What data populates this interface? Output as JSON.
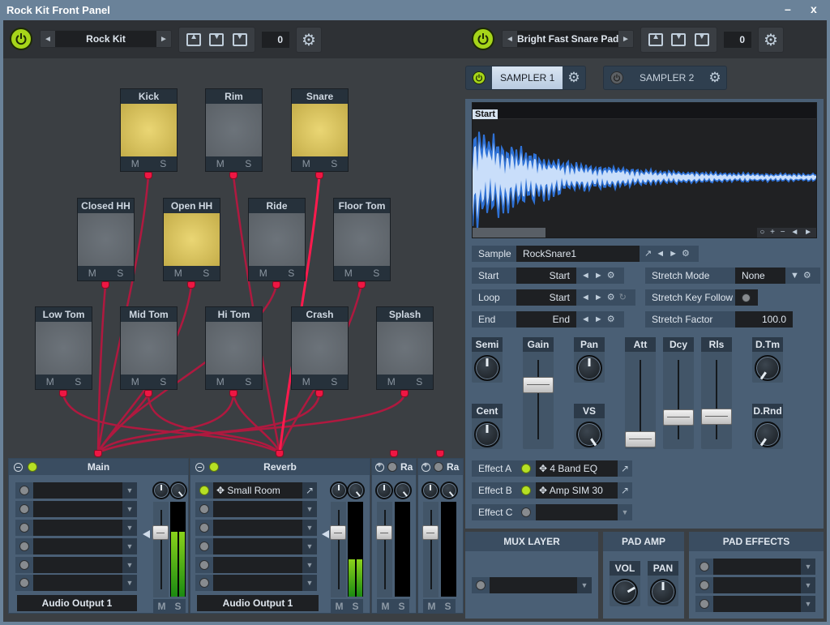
{
  "window": {
    "title": "Rock Kit Front Panel",
    "minimize_label": "–",
    "close_label": "x"
  },
  "left_toolbar": {
    "preset_name": "Rock Kit",
    "number_value": "0"
  },
  "right_toolbar": {
    "preset_name": "Bright Fast Snare Pad",
    "number_value": "0"
  },
  "icons": {
    "prev": "◄",
    "next": "►",
    "dropdown": "▼",
    "gear": "⚙",
    "external": "↗",
    "move": "✥",
    "loop": "↻"
  },
  "pads": [
    {
      "name": "Kick",
      "active": true,
      "mute": "M",
      "solo": "S"
    },
    {
      "name": "Rim",
      "active": false,
      "mute": "M",
      "solo": "S"
    },
    {
      "name": "Snare",
      "active": true,
      "mute": "M",
      "solo": "S"
    },
    {
      "name": "Closed HH",
      "active": false,
      "mute": "M",
      "solo": "S"
    },
    {
      "name": "Open HH",
      "active": true,
      "mute": "M",
      "solo": "S"
    },
    {
      "name": "Ride",
      "active": false,
      "mute": "M",
      "solo": "S"
    },
    {
      "name": "Floor Tom",
      "active": false,
      "mute": "M",
      "solo": "S"
    },
    {
      "name": "Low Tom",
      "active": false,
      "mute": "M",
      "solo": "S"
    },
    {
      "name": "Mid Tom",
      "active": false,
      "mute": "M",
      "solo": "S"
    },
    {
      "name": "Hi Tom",
      "active": false,
      "mute": "M",
      "solo": "S"
    },
    {
      "name": "Crash",
      "active": false,
      "mute": "M",
      "solo": "S"
    },
    {
      "name": "Splash",
      "active": false,
      "mute": "M",
      "solo": "S"
    }
  ],
  "mixer": {
    "main": {
      "name": "Main",
      "insert_slot_1": "",
      "output": "Audio Output 1",
      "mute": "M",
      "solo": "S",
      "meter_level": 0.68
    },
    "reverb": {
      "name": "Reverb",
      "insert_slot_1": "Small Room",
      "output": "Audio Output 1",
      "mute": "M",
      "solo": "S",
      "meter_level": 0.39
    },
    "aux1": {
      "name": "Ra",
      "mute": "M",
      "solo": "S",
      "meter_level": 0
    },
    "aux2": {
      "name": "Ra",
      "mute": "M",
      "solo": "S",
      "meter_level": 0
    }
  },
  "sampler_tabs": [
    {
      "label": "SAMPLER 1",
      "active": true,
      "power": true
    },
    {
      "label": "SAMPLER 2",
      "active": false,
      "power": false
    }
  ],
  "waveform": {
    "marker_label": "Start",
    "controls": "○ + − ◄ ►"
  },
  "sample_params": {
    "sample": {
      "label": "Sample",
      "value": "RockSnare1"
    },
    "start": {
      "label": "Start",
      "value": "Start"
    },
    "loop": {
      "label": "Loop",
      "value": "Start"
    },
    "end": {
      "label": "End",
      "value": "End"
    },
    "stretch_mode": {
      "label": "Stretch Mode",
      "value": "None"
    },
    "stretch_key_follow": {
      "label": "Stretch Key Follow",
      "value": false
    },
    "stretch_factor": {
      "label": "Stretch Factor",
      "value": "100.0"
    }
  },
  "controls": {
    "semi": {
      "label": "Semi"
    },
    "cent": {
      "label": "Cent"
    },
    "gain": {
      "label": "Gain",
      "level": 0.75
    },
    "pan": {
      "label": "Pan"
    },
    "vs": {
      "label": "VS"
    },
    "att": {
      "label": "Att",
      "level": 0.02
    },
    "dcy": {
      "label": "Dcy",
      "level": 0.32
    },
    "rls": {
      "label": "Rls",
      "level": 0.33
    },
    "dtm": {
      "label": "D.Tm"
    },
    "drnd": {
      "label": "D.Rnd"
    }
  },
  "effects": [
    {
      "label": "Effect A",
      "on": true,
      "value": "4 Band EQ"
    },
    {
      "label": "Effect B",
      "on": true,
      "value": "Amp SIM 30"
    },
    {
      "label": "Effect C",
      "on": false,
      "value": ""
    }
  ],
  "bottom": {
    "mux_layer": {
      "title": "MUX LAYER"
    },
    "pad_amp": {
      "title": "PAD AMP",
      "vol_label": "VOL",
      "pan_label": "PAN"
    },
    "pad_effects": {
      "title": "PAD EFFECTS"
    }
  }
}
